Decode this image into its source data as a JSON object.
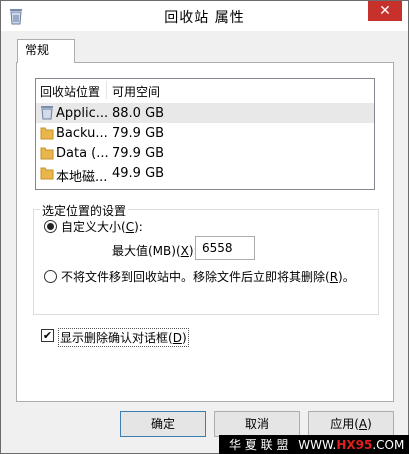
{
  "window": {
    "title": "回收站 属性",
    "close_glyph": "✕"
  },
  "tabs": [
    {
      "label": "常规",
      "active": true
    }
  ],
  "locations": {
    "headers": [
      "回收站位置",
      "可用空间"
    ],
    "rows": [
      {
        "name": "Applic...",
        "space": "88.0 GB",
        "icon": "recycle-bin-icon",
        "selected": true
      },
      {
        "name": "Backu...",
        "space": "79.9 GB",
        "icon": "folder-icon",
        "selected": false
      },
      {
        "name": "Data (...",
        "space": "79.9 GB",
        "icon": "folder-icon",
        "selected": false
      },
      {
        "name": "本地磁...",
        "space": "49.9 GB",
        "icon": "folder-icon",
        "selected": false
      }
    ]
  },
  "settings": {
    "legend": "选定位置的设置",
    "custom_size_label": "自定义大小",
    "custom_size_key": "C",
    "max_label": "最大值(MB)",
    "max_key": "X",
    "max_value": "6558",
    "no_recycle_label": "不将文件移到回收站中。移除文件后立即将其删除",
    "no_recycle_key": "R",
    "selected_option": "custom"
  },
  "confirm": {
    "label": "显示删除确认对话框",
    "key": "D",
    "checked": true,
    "check_glyph": "✔"
  },
  "buttons": {
    "ok": "确定",
    "cancel": "取消",
    "apply": "应用",
    "apply_key": "A"
  },
  "watermark": {
    "brand": "华 夏 联 盟",
    "url_prefix": "WWW.",
    "url_highlight": "HX95",
    "url_suffix": ".COM"
  },
  "colors": {
    "close_button": "#c7312c",
    "folder": "#e8b64a"
  }
}
